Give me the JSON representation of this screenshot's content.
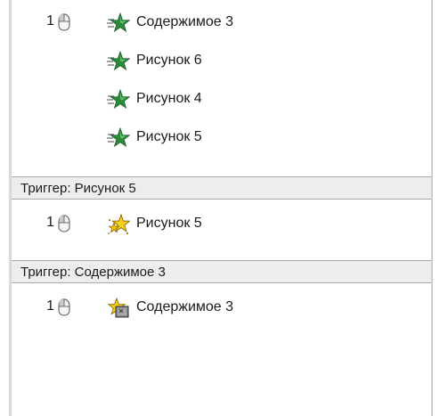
{
  "colors": {
    "trigger_bg": "#ededed",
    "entrance_effect": "#2a8a3a",
    "emphasis_effect": "#f2c200"
  },
  "groups": [
    {
      "items": [
        {
          "order": "1",
          "start": "on-click",
          "effect_icon": "entrance-star-green-icon",
          "label": "Содержимое 3"
        },
        {
          "order": "",
          "start": "with-previous",
          "effect_icon": "entrance-star-green-icon",
          "label": "Рисунок 6"
        },
        {
          "order": "",
          "start": "with-previous",
          "effect_icon": "entrance-star-green-icon",
          "label": "Рисунок 4"
        },
        {
          "order": "",
          "start": "with-previous",
          "effect_icon": "entrance-star-green-icon",
          "label": "Рисунок 5"
        }
      ]
    },
    {
      "trigger_label": "Триггер: Рисунок 5",
      "items": [
        {
          "order": "1",
          "start": "on-click",
          "effect_icon": "emphasis-star-yellow-icon",
          "label": "Рисунок 5"
        }
      ]
    },
    {
      "trigger_label": "Триггер: Содержимое 3",
      "items": [
        {
          "order": "1",
          "start": "on-click",
          "effect_icon": "emphasis-star-box-icon",
          "label": "Содержимое 3"
        }
      ]
    }
  ]
}
